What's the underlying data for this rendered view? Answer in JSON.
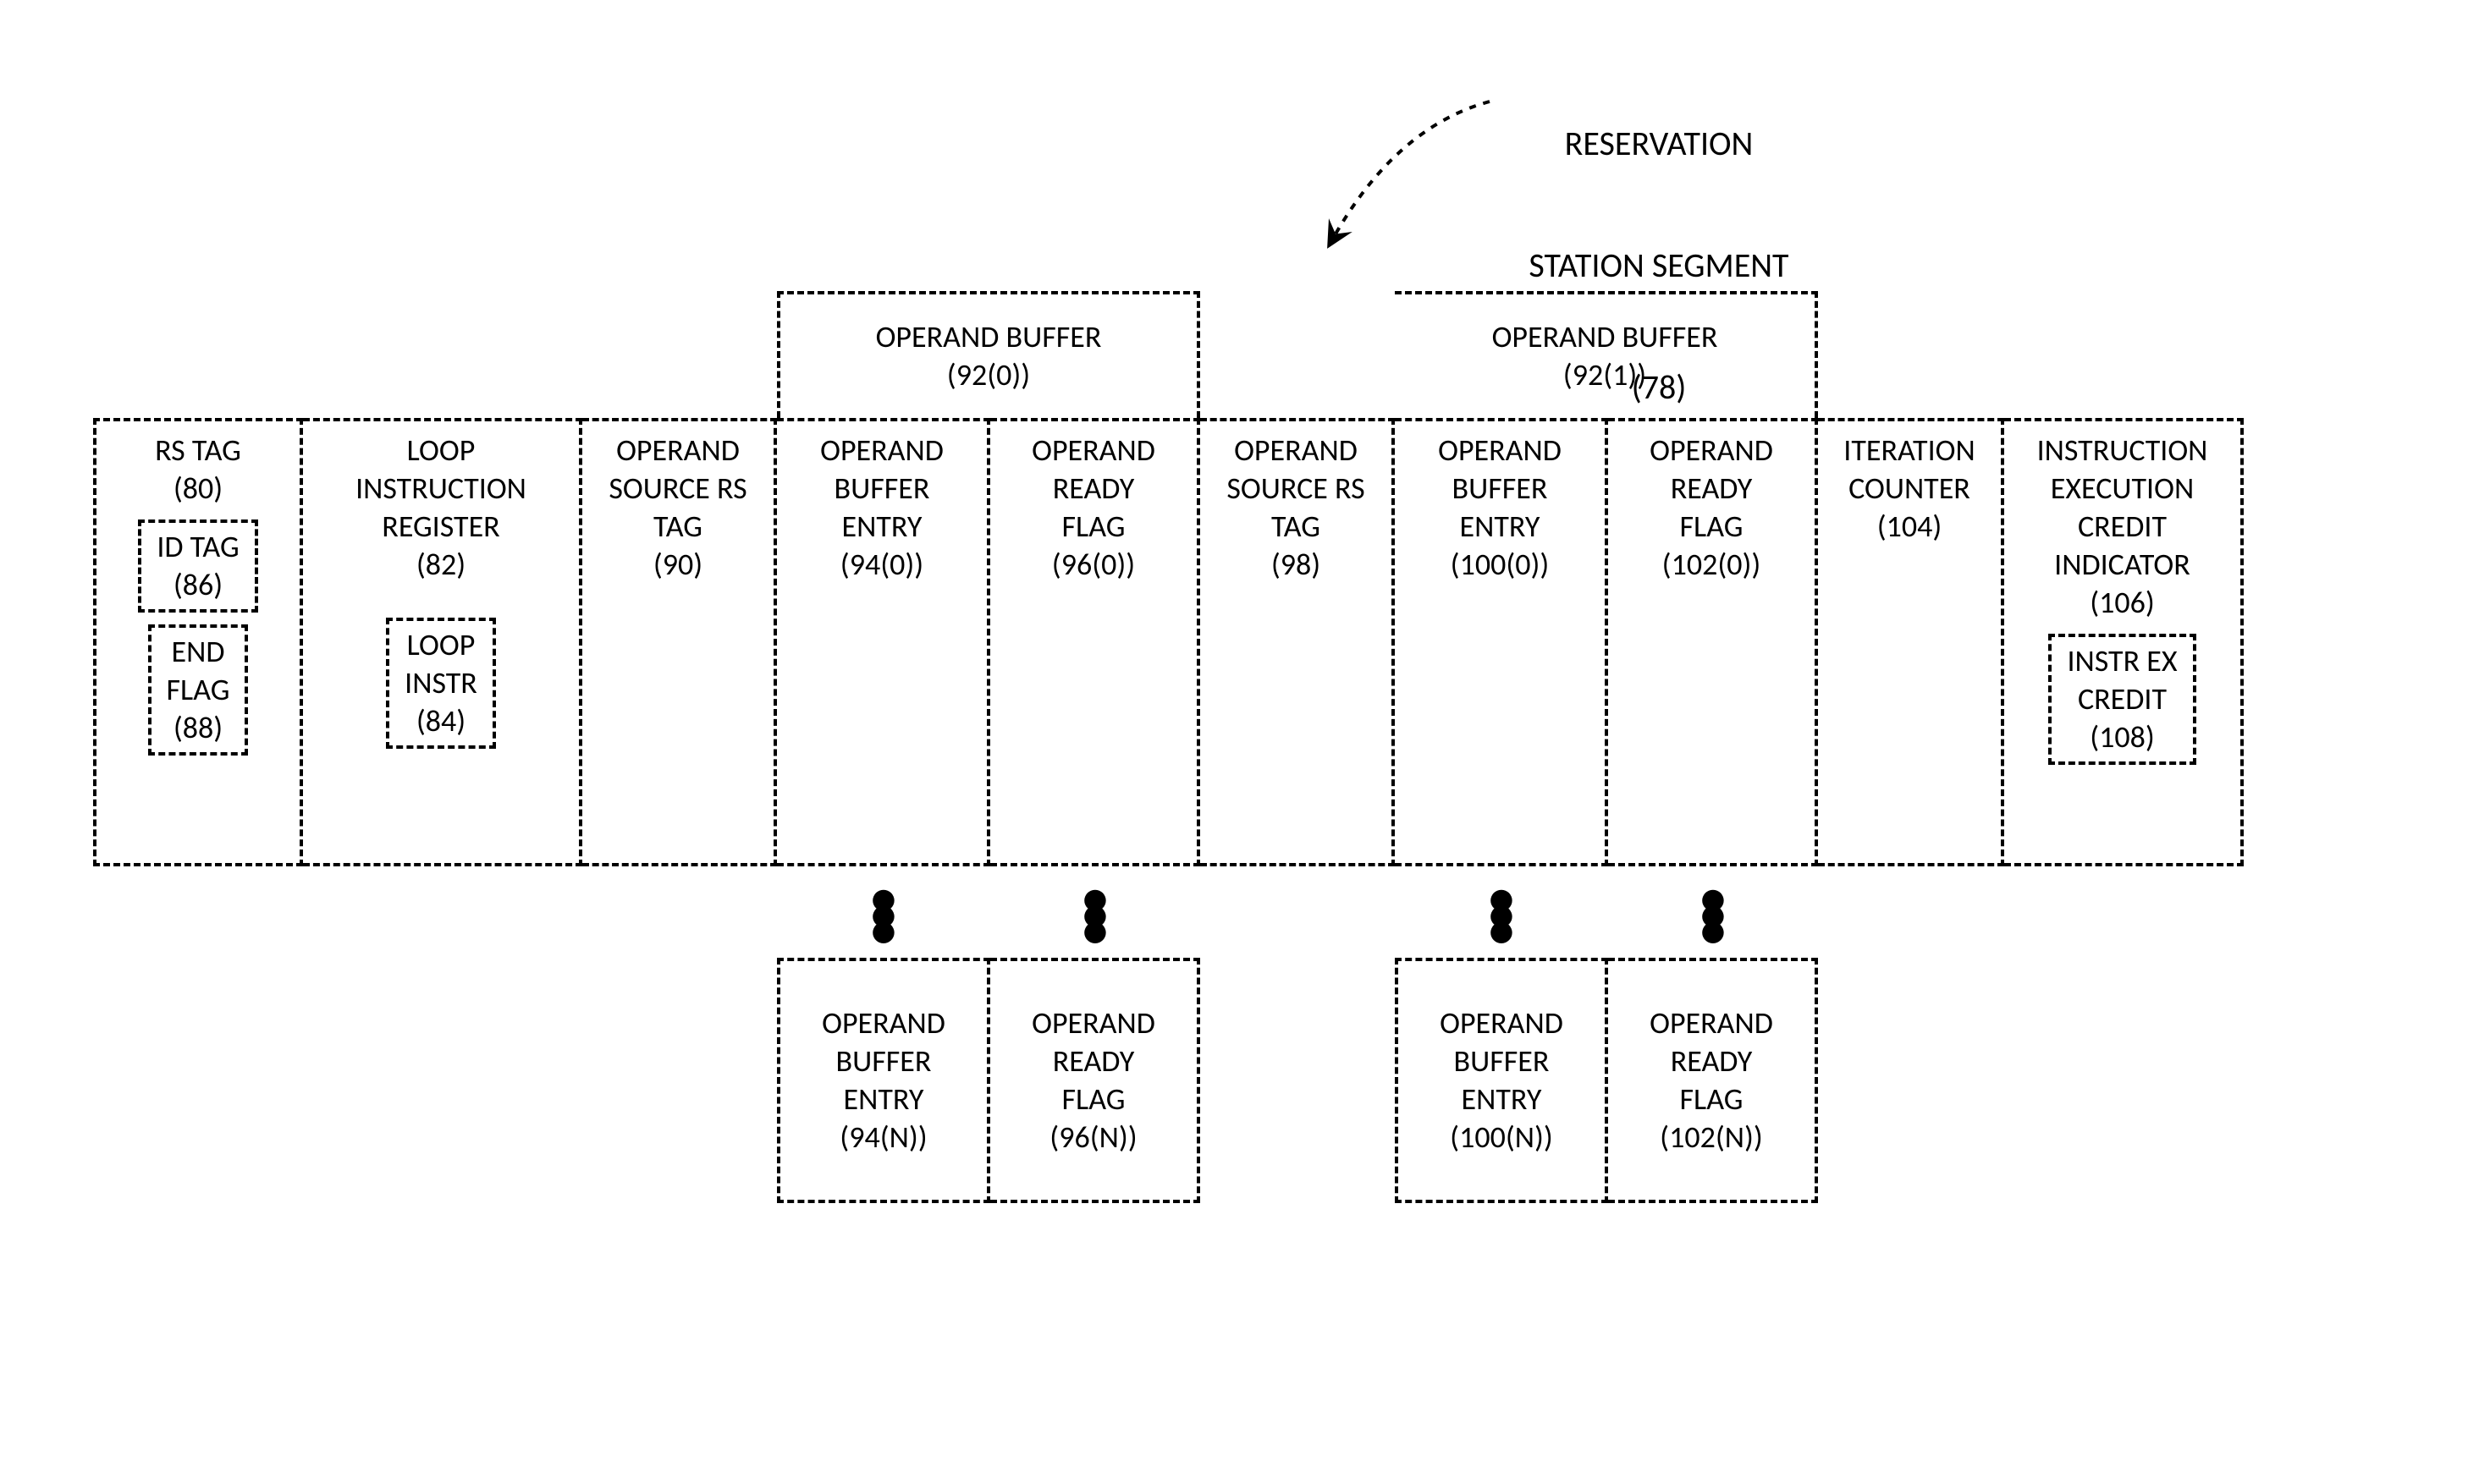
{
  "title": {
    "line1": "RESERVATION",
    "line2": "STATION SEGMENT",
    "line3": "(78)"
  },
  "headers": {
    "opbuf0": "OPERAND BUFFER\n(92(0))",
    "opbuf1": "OPERAND BUFFER\n(92(1))"
  },
  "cells": {
    "rstag": "RS TAG\n(80)",
    "idtag": "ID TAG\n(86)",
    "endflag": "END\nFLAG\n(88)",
    "loopir": "LOOP\nINSTRUCTION\nREGISTER\n(82)",
    "loopinstr": "LOOP\nINSTR\n(84)",
    "opsrc0": "OPERAND\nSOURCE RS\nTAG\n(90)",
    "opbufentry0": "OPERAND\nBUFFER\nENTRY\n(94(0))",
    "opready0": "OPERAND\nREADY\nFLAG\n(96(0))",
    "opsrc1": "OPERAND\nSOURCE RS\nTAG\n(98)",
    "opbufentry1": "OPERAND\nBUFFER\nENTRY\n(100(0))",
    "opready1": "OPERAND\nREADY\nFLAG\n(102(0))",
    "itercounter": "ITERATION\nCOUNTER\n(104)",
    "instrex": "INSTRUCTION\nEXECUTION\nCREDIT\nINDICATOR\n(106)",
    "instrexcredit": "INSTR EX\nCREDIT\n(108)",
    "opbufentry0n": "OPERAND\nBUFFER\nENTRY\n(94(N))",
    "opready0n": "OPERAND\nREADY\nFLAG\n(96(N))",
    "opbufentry1n": "OPERAND\nBUFFER\nENTRY\n(100(N))",
    "opready1n": "OPERAND\nREADY\nFLAG\n(102(N))"
  }
}
